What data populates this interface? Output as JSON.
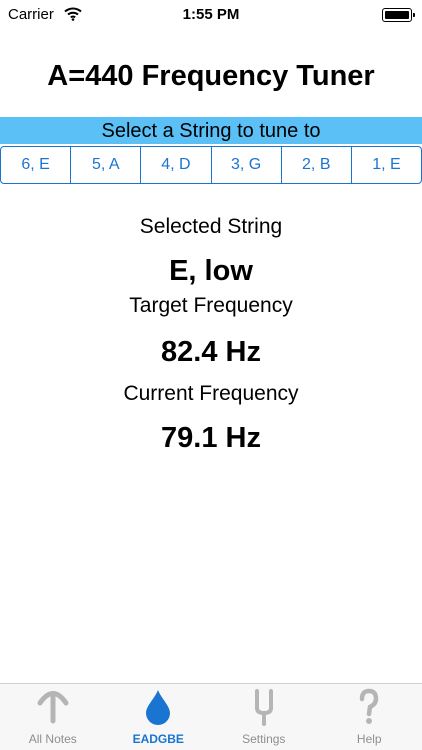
{
  "status": {
    "carrier": "Carrier",
    "time": "1:55 PM"
  },
  "title": "A=440 Frequency Tuner",
  "select_prompt": "Select a String to tune to",
  "strings": [
    "6, E",
    "5, A",
    "4, D",
    "3, G",
    "2, B",
    "1, E"
  ],
  "selected_string": {
    "label": "Selected String",
    "value": "E, low"
  },
  "target_frequency": {
    "label": "Target Frequency",
    "value": "82.4 Hz"
  },
  "current_frequency": {
    "label": "Current Frequency",
    "value": "79.1 Hz"
  },
  "tabs": [
    {
      "label": "All Notes",
      "icon": "tuning-fork-curve-icon"
    },
    {
      "label": "EADGBE",
      "icon": "drop-icon"
    },
    {
      "label": "Settings",
      "icon": "tuning-fork-icon"
    },
    {
      "label": "Help",
      "icon": "question-icon"
    }
  ],
  "colors": {
    "accent": "#1a75d2",
    "banner": "#5ac0f5"
  }
}
